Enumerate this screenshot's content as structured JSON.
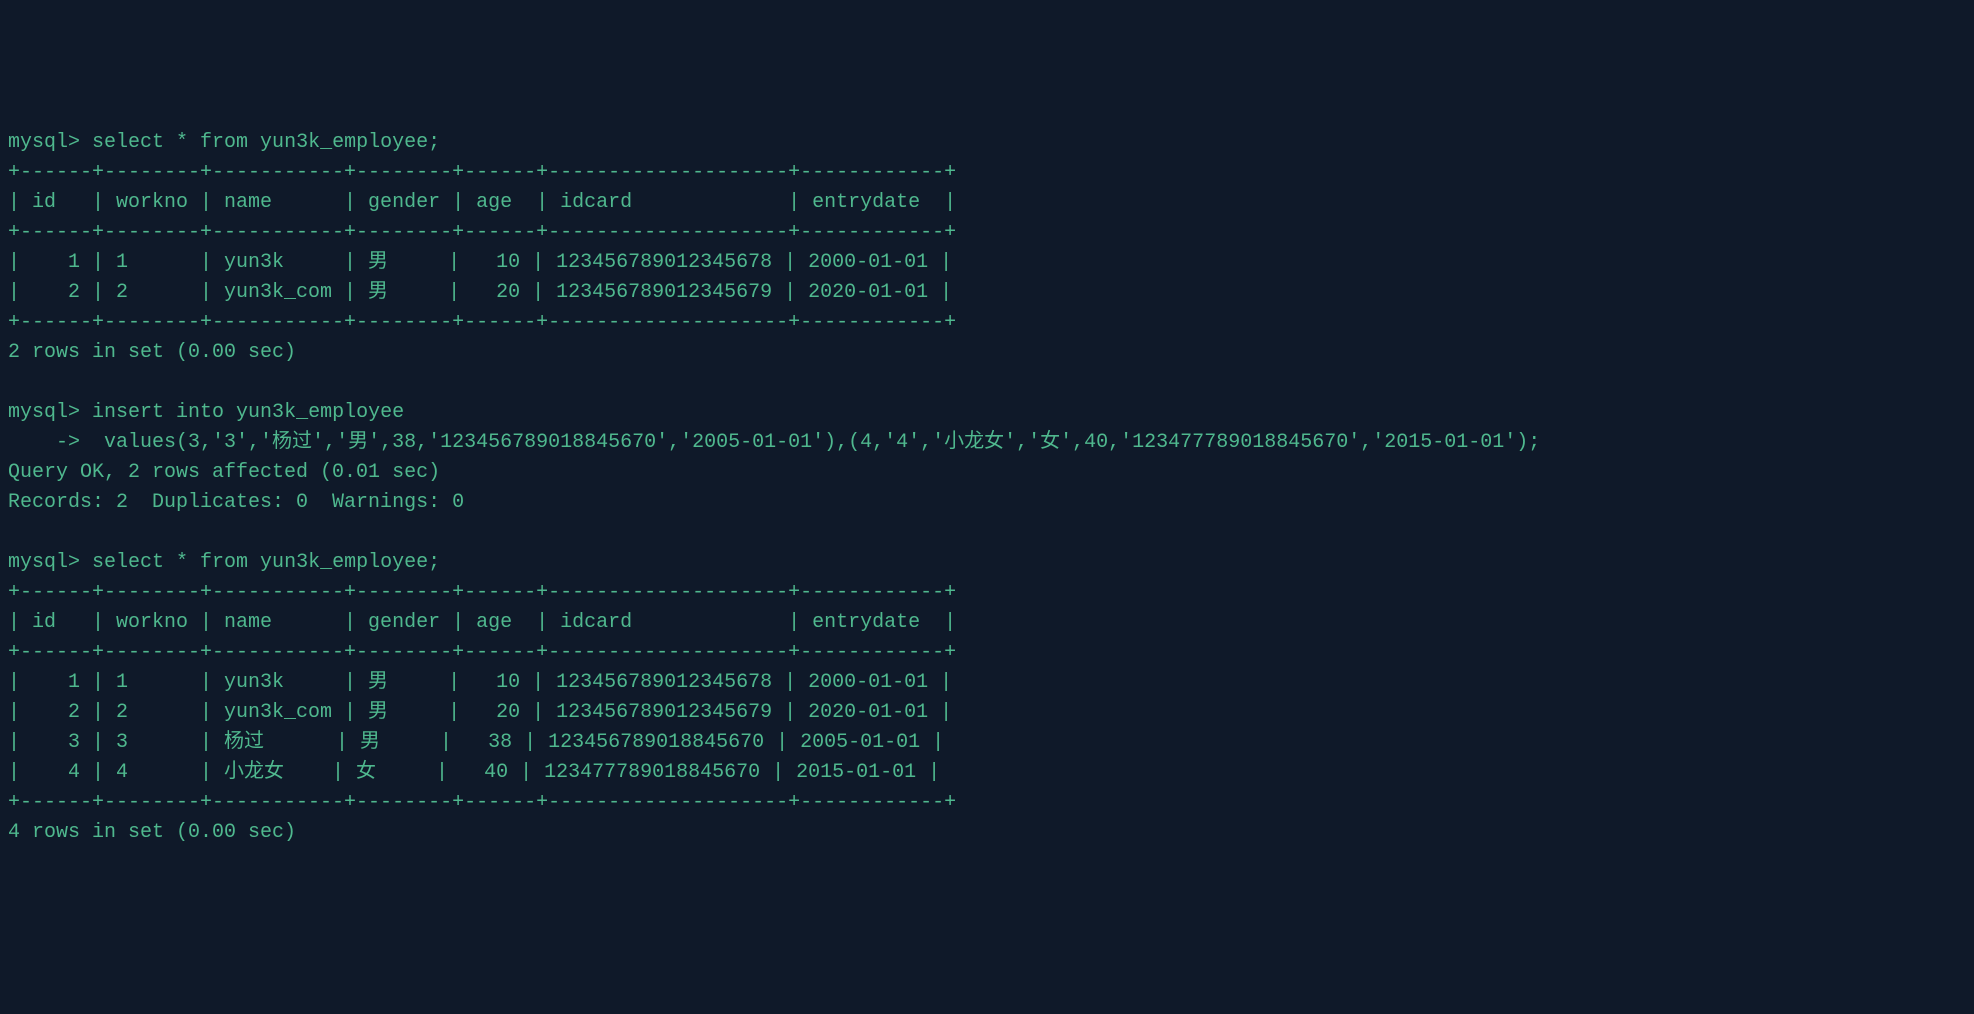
{
  "terminal": {
    "prompt": "mysql>",
    "continuation": "    ->",
    "queries": {
      "select1": "select * from yun3k_employee;",
      "insert_line1": "insert into yun3k_employee",
      "insert_line2": " values(3,'3','杨过','男',38,'123456789018845670','2005-01-01'),(4,'4','小龙女','女',40,'123477789018845670','2015-01-01');",
      "select2": "select * from yun3k_employee;"
    },
    "table_border": "+------+--------+-----------+--------+------+--------------------+------------+",
    "table_header": "| id   | workno | name      | gender | age  | idcard             | entrydate  |",
    "table1_rows": [
      "|    1 | 1      | yun3k     | 男     |   10 | 123456789012345678 | 2000-01-01 |",
      "|    2 | 2      | yun3k_com | 男     |   20 | 123456789012345679 | 2020-01-01 |"
    ],
    "table1_footer": "2 rows in set (0.00 sec)",
    "insert_result1": "Query OK, 2 rows affected (0.01 sec)",
    "insert_result2": "Records: 2  Duplicates: 0  Warnings: 0",
    "table2_rows": [
      "|    1 | 1      | yun3k     | 男     |   10 | 123456789012345678 | 2000-01-01 |",
      "|    2 | 2      | yun3k_com | 男     |   20 | 123456789012345679 | 2020-01-01 |",
      "|    3 | 3      | 杨过      | 男     |   38 | 123456789018845670 | 2005-01-01 |",
      "|    4 | 4      | 小龙女    | 女     |   40 | 123477789018845670 | 2015-01-01 |"
    ],
    "table2_footer": "4 rows in set (0.00 sec)"
  },
  "chart_data": {
    "type": "table",
    "tables": [
      {
        "title": "yun3k_employee (before insert)",
        "columns": [
          "id",
          "workno",
          "name",
          "gender",
          "age",
          "idcard",
          "entrydate"
        ],
        "rows": [
          [
            1,
            "1",
            "yun3k",
            "男",
            10,
            "123456789012345678",
            "2000-01-01"
          ],
          [
            2,
            "2",
            "yun3k_com",
            "男",
            20,
            "123456789012345679",
            "2020-01-01"
          ]
        ]
      },
      {
        "title": "yun3k_employee (after insert)",
        "columns": [
          "id",
          "workno",
          "name",
          "gender",
          "age",
          "idcard",
          "entrydate"
        ],
        "rows": [
          [
            1,
            "1",
            "yun3k",
            "男",
            10,
            "123456789012345678",
            "2000-01-01"
          ],
          [
            2,
            "2",
            "yun3k_com",
            "男",
            20,
            "123456789012345679",
            "2020-01-01"
          ],
          [
            3,
            "3",
            "杨过",
            "男",
            38,
            "123456789018845670",
            "2005-01-01"
          ],
          [
            4,
            "4",
            "小龙女",
            "女",
            40,
            "123477789018845670",
            "2015-01-01"
          ]
        ]
      }
    ]
  }
}
